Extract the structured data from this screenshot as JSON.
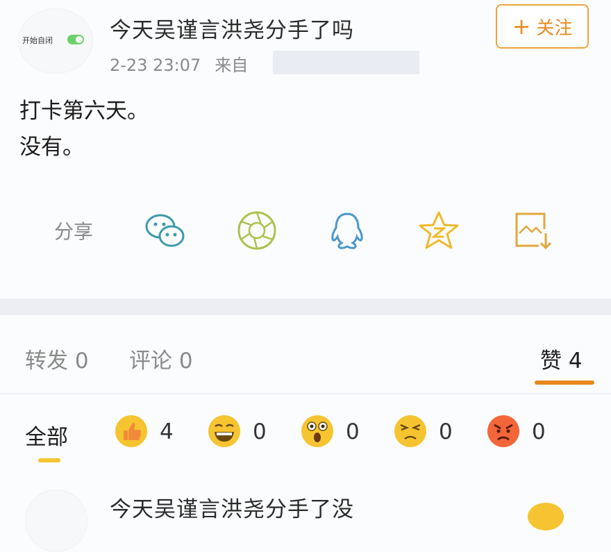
{
  "post": {
    "title": "今天吴谨言洪尧分手了吗",
    "time": "2-23 23:07",
    "source_prefix": "来自",
    "avatar_text": "开始自闭",
    "follow_label": "关注",
    "body_line1": "打卡第六天。",
    "body_line2": "没有。"
  },
  "share": {
    "label": "分享",
    "icons": [
      "wechat-icon",
      "moments-icon",
      "qq-icon",
      "qzone-icon",
      "save-image-icon"
    ]
  },
  "tabs": {
    "repost": "转发 0",
    "comment": "评论 0",
    "like": "赞 4"
  },
  "reactions": {
    "all_label": "全部",
    "items": [
      {
        "icon": "thumbs-up-icon",
        "count": "4"
      },
      {
        "icon": "laugh-icon",
        "count": "0"
      },
      {
        "icon": "surprised-icon",
        "count": "0"
      },
      {
        "icon": "sad-icon",
        "count": "0"
      },
      {
        "icon": "angry-icon",
        "count": "0"
      }
    ]
  },
  "next_item": {
    "title": "今天吴谨言洪尧分手了没"
  },
  "colors": {
    "accent": "#e8891d",
    "follow_border": "#f0a23b",
    "muted_text": "#8a8a8a"
  }
}
